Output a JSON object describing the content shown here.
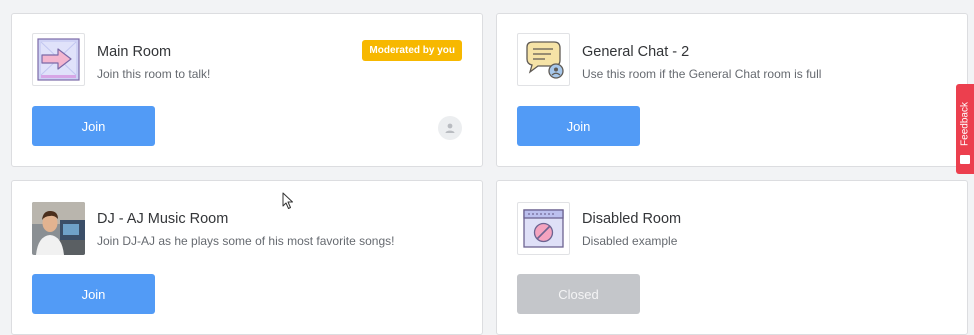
{
  "rooms": [
    {
      "title": "Main Room",
      "description": "Join this room to talk!",
      "badge": "Moderated by you",
      "button_label": "Join",
      "icon": "arrow-enter-icon"
    },
    {
      "title": "General Chat - 2",
      "description": "Use this room if the General Chat room is full",
      "button_label": "Join",
      "icon": "chat-bubble-icon"
    },
    {
      "title": "DJ - AJ Music Room",
      "description": "Join DJ-AJ as he plays some of his most favorite songs!",
      "button_label": "Join",
      "icon": "dj-photo-icon"
    },
    {
      "title": "Disabled Room",
      "description": "Disabled example",
      "button_label": "Closed",
      "icon": "disabled-window-icon"
    }
  ],
  "feedback": {
    "label": "Feedback"
  },
  "colors": {
    "join_button": "#529bf6",
    "closed_button": "#c4c6ca",
    "badge": "#f7b800",
    "feedback_tab": "#ec3f4e"
  }
}
